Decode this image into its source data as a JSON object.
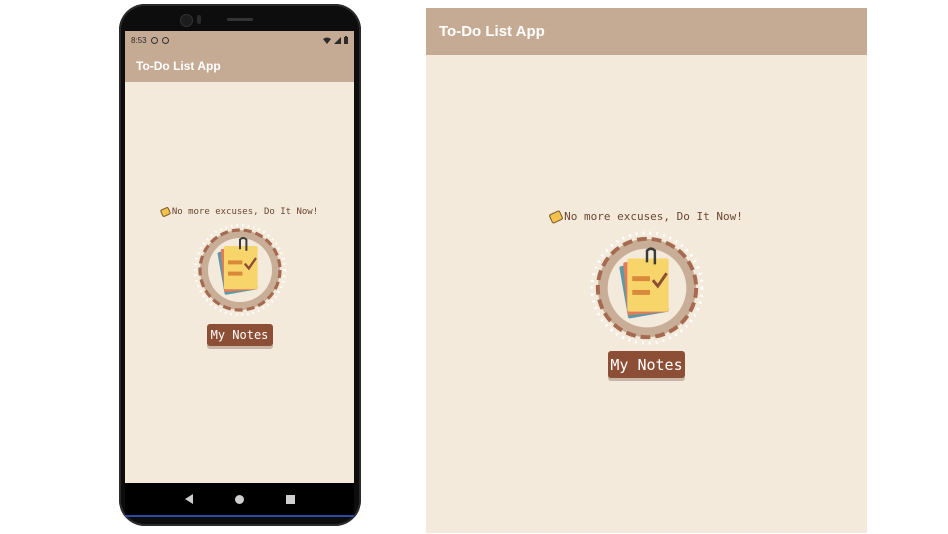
{
  "phone": {
    "status": {
      "time": "8:53"
    },
    "app_title": "To-Do List App",
    "tagline": "No more excuses, Do It Now!",
    "button_label": "My Notes"
  },
  "preview": {
    "app_title": "To-Do List App",
    "tagline": "No more excuses, Do It Now!",
    "button_label": "My Notes"
  },
  "colors": {
    "appbar": "#c6ab94",
    "background": "#f3eadb",
    "button": "#8c4f36",
    "ring": "#a56a50"
  },
  "icons": [
    "tag-icon",
    "notepad-checklist-icon",
    "wifi-icon",
    "signal-icon",
    "battery-icon",
    "back-icon",
    "home-icon",
    "recents-icon"
  ]
}
